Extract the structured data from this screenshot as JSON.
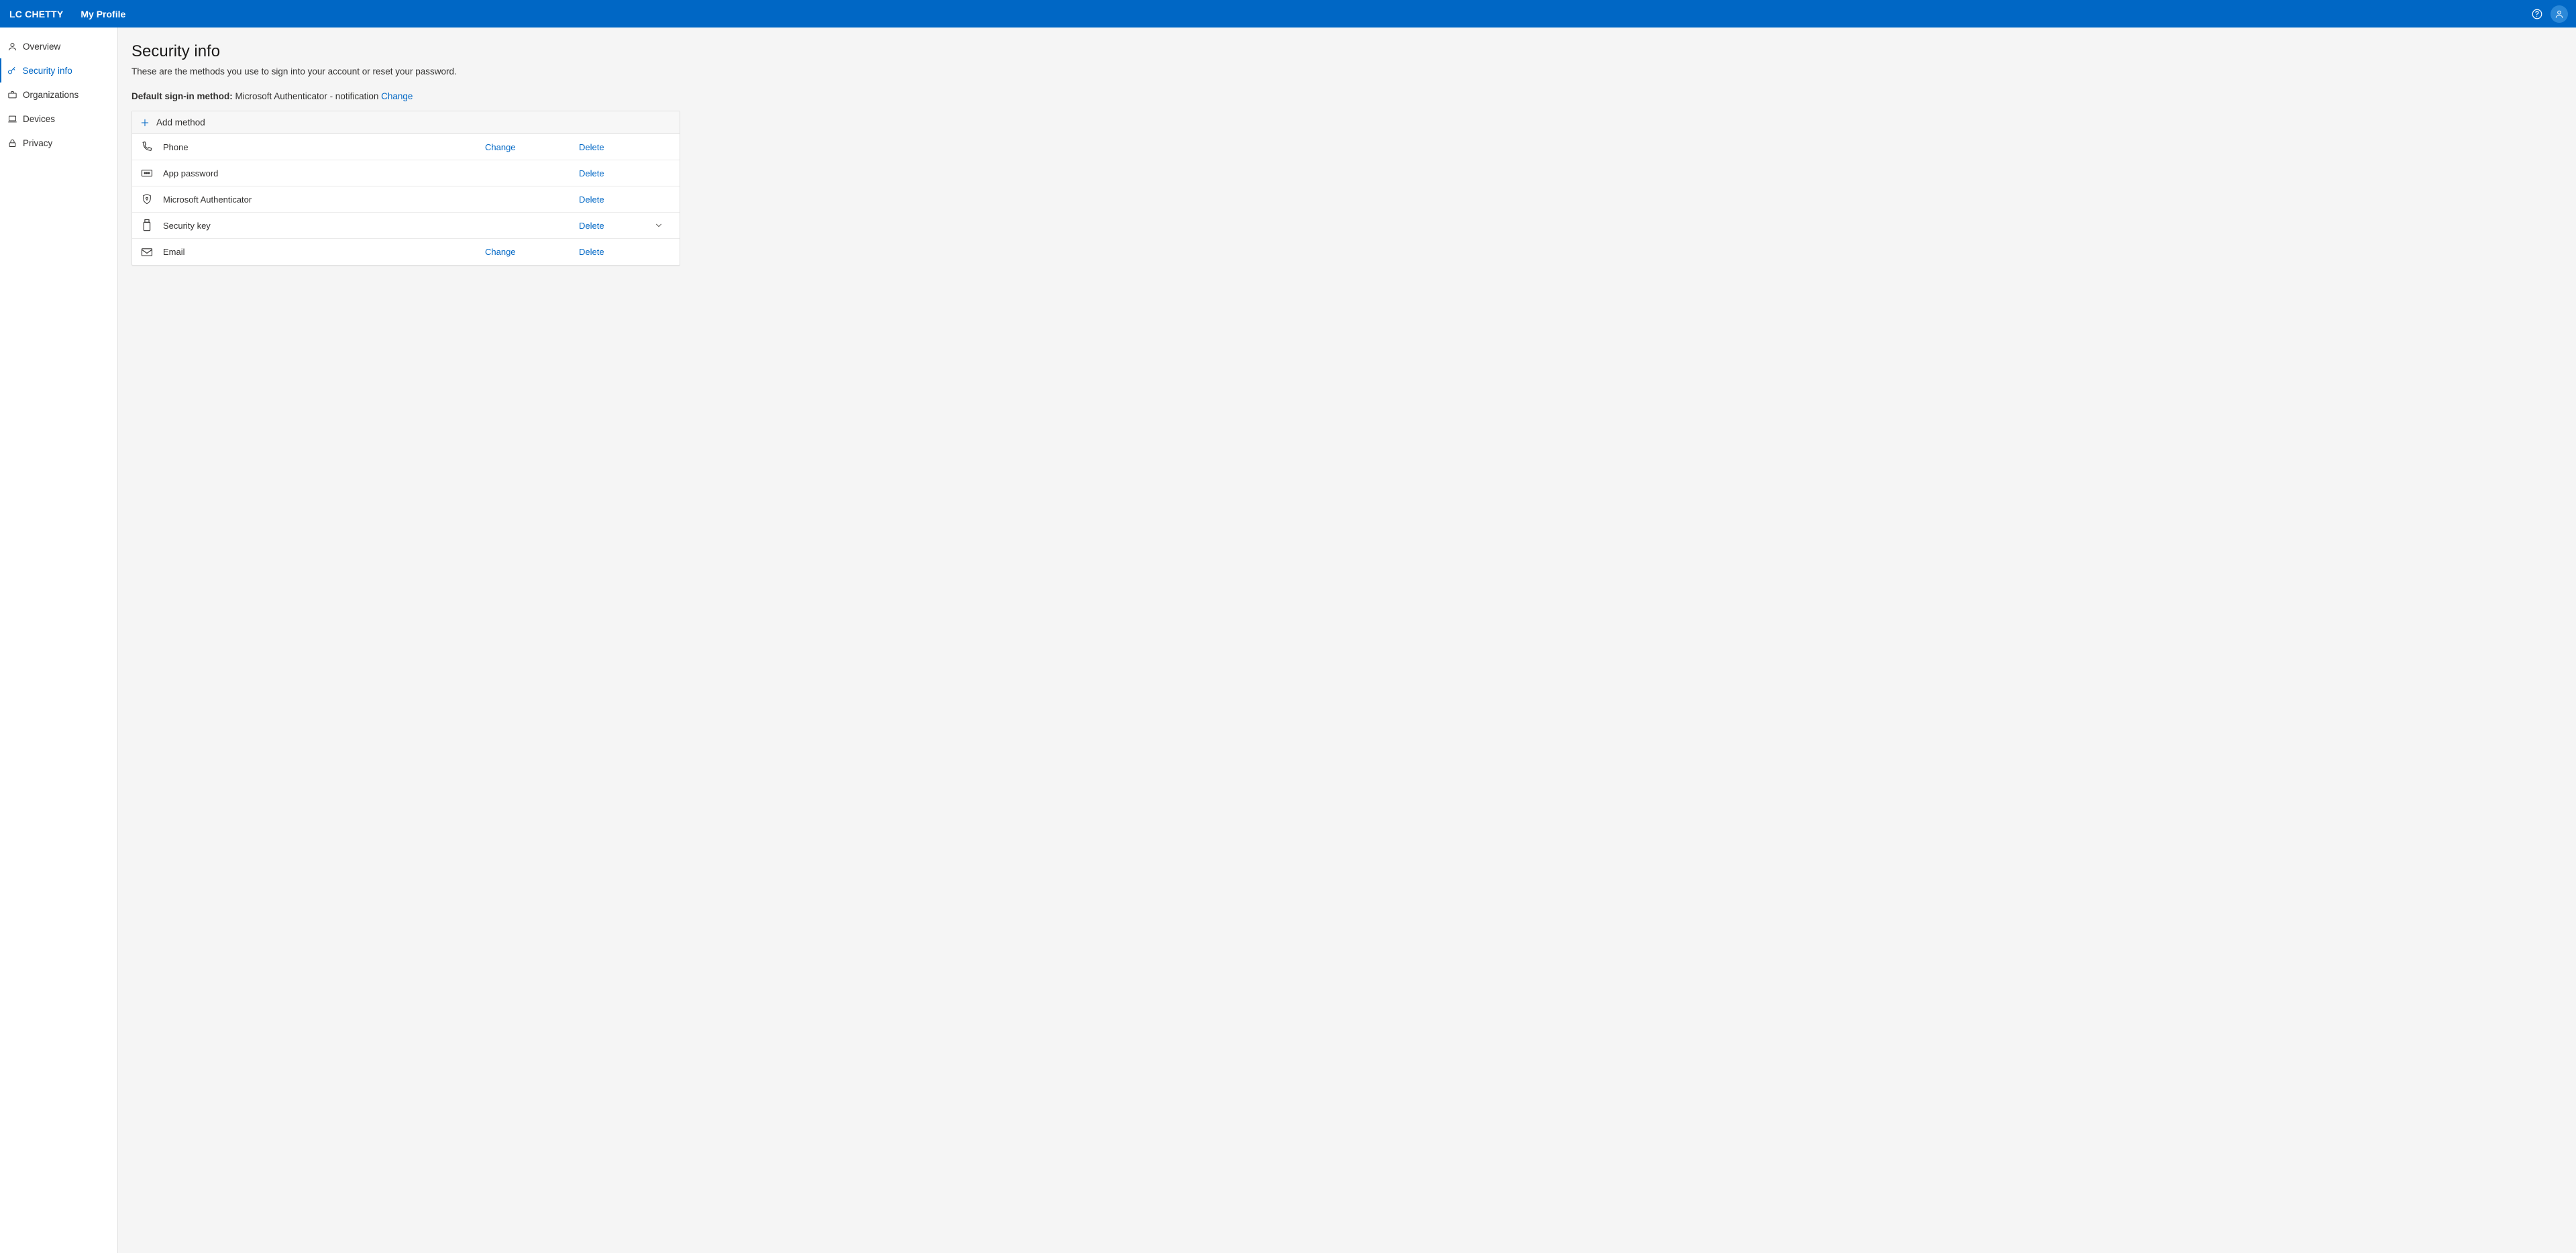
{
  "header": {
    "org": "LC CHETTY",
    "app": "My Profile"
  },
  "sidebar": {
    "items": [
      {
        "label": "Overview"
      },
      {
        "label": "Security info"
      },
      {
        "label": "Organizations"
      },
      {
        "label": "Devices"
      },
      {
        "label": "Privacy"
      }
    ]
  },
  "main": {
    "title": "Security info",
    "subtitle": "These are the methods you use to sign into your account or reset your password.",
    "default_label": "Default sign-in method:",
    "default_value": " Microsoft Authenticator - notification ",
    "change_link": "Change",
    "add_method": "Add method",
    "actions": {
      "change": "Change",
      "delete": "Delete"
    },
    "methods": [
      {
        "name": "Phone",
        "change": true,
        "delete": true,
        "expand": false
      },
      {
        "name": "App password",
        "change": false,
        "delete": true,
        "expand": false
      },
      {
        "name": "Microsoft Authenticator",
        "change": false,
        "delete": true,
        "expand": false
      },
      {
        "name": "Security key",
        "change": false,
        "delete": true,
        "expand": true
      },
      {
        "name": "Email",
        "change": true,
        "delete": true,
        "expand": false
      }
    ]
  }
}
